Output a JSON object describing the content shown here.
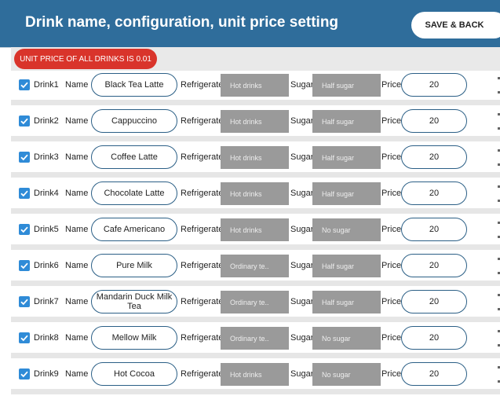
{
  "header": {
    "title": "Drink name, configuration, unit price setting",
    "save_label": "SAVE & BACK"
  },
  "notice": "UNIT PRICE OF ALL DRINKS IS 0.01",
  "labels": {
    "name": "Name",
    "refrigerate": "Refrigerate",
    "sugar": "Sugar",
    "price": "Price"
  },
  "rows": [
    {
      "drink": "Drink1",
      "checked": true,
      "name": "Black Tea Latte",
      "refrigerate": "Hot drinks",
      "sugar": "Half sugar",
      "price": "20"
    },
    {
      "drink": "Drink2",
      "checked": true,
      "name": "Cappuccino",
      "refrigerate": "Hot drinks",
      "sugar": "Half sugar",
      "price": "20"
    },
    {
      "drink": "Drink3",
      "checked": true,
      "name": "Coffee Latte",
      "refrigerate": "Hot drinks",
      "sugar": "Half sugar",
      "price": "20"
    },
    {
      "drink": "Drink4",
      "checked": true,
      "name": "Chocolate Latte",
      "refrigerate": "Hot drinks",
      "sugar": "Half sugar",
      "price": "20"
    },
    {
      "drink": "Drink5",
      "checked": true,
      "name": "Cafe Americano",
      "refrigerate": "Hot drinks",
      "sugar": "No sugar",
      "price": "20"
    },
    {
      "drink": "Drink6",
      "checked": true,
      "name": "Pure Milk",
      "refrigerate": "Ordinary te..",
      "sugar": "Half sugar",
      "price": "20"
    },
    {
      "drink": "Drink7",
      "checked": true,
      "name": "Mandarin Duck Milk Tea",
      "refrigerate": "Ordinary te..",
      "sugar": "Half sugar",
      "price": "20"
    },
    {
      "drink": "Drink8",
      "checked": true,
      "name": "Mellow Milk",
      "refrigerate": "Ordinary te..",
      "sugar": "No sugar",
      "price": "20"
    },
    {
      "drink": "Drink9",
      "checked": true,
      "name": "Hot Cocoa",
      "refrigerate": "Hot drinks",
      "sugar": "No sugar",
      "price": "20"
    }
  ],
  "colors": {
    "header": "#2f6d9b",
    "notice": "#d9342b",
    "checkbox": "#2f8bd7",
    "select": "#9a9a9a"
  }
}
